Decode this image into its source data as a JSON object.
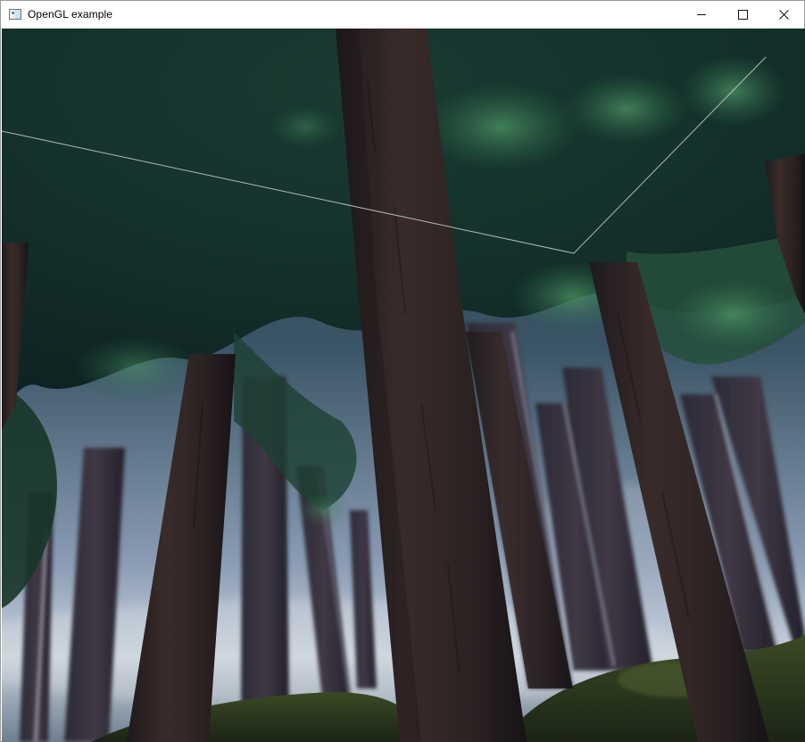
{
  "window": {
    "title": "OpenGL example"
  },
  "controls": {
    "minimize_icon": "minimize-icon",
    "maximize_icon": "maximize-icon",
    "close_icon": "close-icon"
  },
  "scene": {
    "description_icon": "3d-forest-render",
    "status_text": "",
    "colors": {
      "canopy_dark": "#15312a",
      "canopy_light": "#3f7a52",
      "sky": "#9fb4cc",
      "trunk": "#2a2122",
      "ground": "#2c3a1f"
    }
  }
}
